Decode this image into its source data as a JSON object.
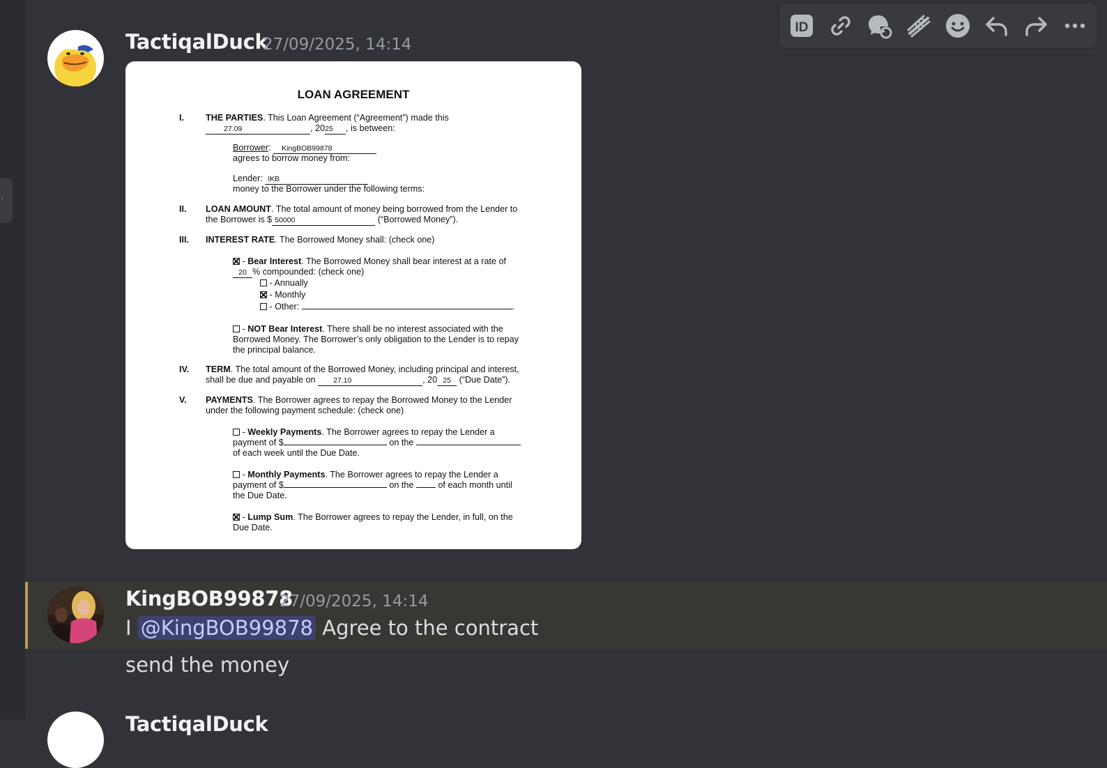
{
  "toolbar": {
    "icons": [
      "id-icon",
      "link-icon",
      "thread-icon",
      "stickers-icon",
      "emoji-icon",
      "reply-icon",
      "forward-icon",
      "more-icon"
    ],
    "labels": {
      "id": "ID"
    }
  },
  "messages": [
    {
      "username": "TactiqalDuck",
      "timestamp": "27/09/2025, 14:14",
      "attachment": {
        "title": "LOAN AGREEMENT",
        "s1_num": "I.",
        "s1_head": "THE PARTIES",
        "s1_text_a": ". This Loan Agreement (“Agreement”) made this",
        "s1_date_fill": "27.09",
        "s1_year_prefix": ", 20",
        "s1_year_fill": "25",
        "s1_text_b": ", is between:",
        "borrower_label": "Borrower",
        "borrower_colon": ":",
        "borrower_fill": "KingBOB99878",
        "borrower_text": "agrees to borrow money from:",
        "lender_label": "Lender:",
        "lender_fill": "IKB",
        "lender_text": "money to the Borrower under the following terms:",
        "s2_num": "II.",
        "s2_head": "LOAN AMOUNT",
        "s2_text_a": ". The total amount of money being borrowed from the Lender to",
        "s2_text_b": "the Borrower is $",
        "s2_fill": "50000",
        "s2_text_c": "(“Borrowed Money”).",
        "s3_num": "III.",
        "s3_head": "INTEREST RATE",
        "s3_text": ". The Borrowed Money shall: (check one)",
        "bear_dash": "-",
        "bear_head": "Bear Interest",
        "bear_text": ". The Borrowed Money shall bear interest at a rate of",
        "bear_rate_fill": "20",
        "bear_text_b": "% compounded: (check one)",
        "opt_annually": "- Annually",
        "opt_monthly": "- Monthly",
        "opt_other": "- Other:",
        "opt_other_end": ".",
        "notbear_dash": "-",
        "notbear_head": "NOT Bear Interest",
        "notbear_text_a": ". There shall be no interest associated with the",
        "notbear_text_b": "Borrowed Money. The Borrower’s only obligation to the Lender is to repay",
        "notbear_text_c": "the principal balance.",
        "s4_num": "IV.",
        "s4_head": "TERM",
        "s4_text_a": ". The total amount of the Borrowed Money, including principal and interest,",
        "s4_text_b": "shall be due and payable on",
        "s4_date_fill": "27.10",
        "s4_year_prefix": ", 20",
        "s4_year_fill": "25",
        "s4_text_c": "(“Due Date”).",
        "s5_num": "V.",
        "s5_head": "PAYMENTS",
        "s5_text_a": ". The Borrower agrees to repay the Borrowed Money to the Lender",
        "s5_text_b": "under the following payment schedule: (check one)",
        "weekly_dash": "-",
        "weekly_head": "Weekly Payments",
        "weekly_text_a": ". The Borrower agrees to repay the Lender a",
        "weekly_text_b": "payment of $",
        "weekly_on": "on the",
        "weekly_text_c": "of each week until the Due Date.",
        "monthly_dash": "-",
        "monthly_head": "Monthly Payments",
        "monthly_text_a": ". The Borrower agrees to repay the Lender a",
        "monthly_text_b": "payment of $",
        "monthly_on": "on the",
        "monthly_text_c": "of each month until",
        "monthly_text_d": "the Due Date.",
        "lump_dash": "-",
        "lump_head": "Lump Sum",
        "lump_text_a": ". The Borrower agrees to repay the Lender, in full, on the",
        "lump_text_b": "Due Date."
      }
    },
    {
      "username": "KingBOB99878",
      "timestamp": "27/09/2025, 14:14",
      "line1_prefix": "I",
      "mention": "@KingBOB99878",
      "line1_suffix": "Agree to the contract",
      "line2": "send the money"
    },
    {
      "username": "TactiqalDuck"
    }
  ],
  "colors": {
    "background": "#323339",
    "highlight_band": "#393733",
    "highlight_bar": "#c59a45",
    "mention_bg": "#3e4271",
    "mention_fg": "#c9cdfb"
  }
}
